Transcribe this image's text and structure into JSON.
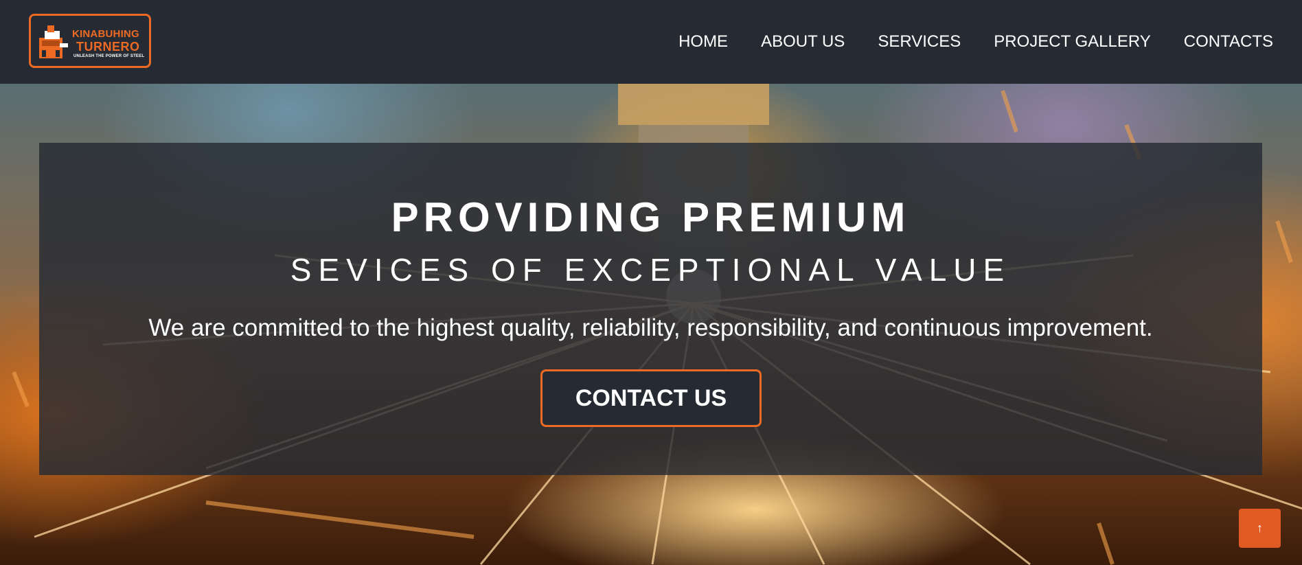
{
  "brand": {
    "line1": "KINABUHING",
    "line2": "TURNERO",
    "slogan": "UNLEASH THE POWER OF STEEL",
    "accent_color": "#ec6a24"
  },
  "nav": {
    "items": [
      {
        "label": "HOME"
      },
      {
        "label": "ABOUT US"
      },
      {
        "label": "SERVICES"
      },
      {
        "label": "PROJECT GALLERY"
      },
      {
        "label": "CONTACTS"
      }
    ]
  },
  "hero": {
    "title": "PROVIDING PREMIUM",
    "subtitle": "SEVICES OF EXCEPTIONAL VALUE",
    "tagline": "We are committed to the highest quality, reliability, responsibility, and continuous improvement.",
    "cta_label": "CONTACT US"
  },
  "scroll_top": {
    "icon": "arrow-up-icon",
    "glyph": "↑",
    "color": "#e05b23"
  },
  "colors": {
    "header_bg": "#262b33",
    "accent": "#ec6a24"
  }
}
